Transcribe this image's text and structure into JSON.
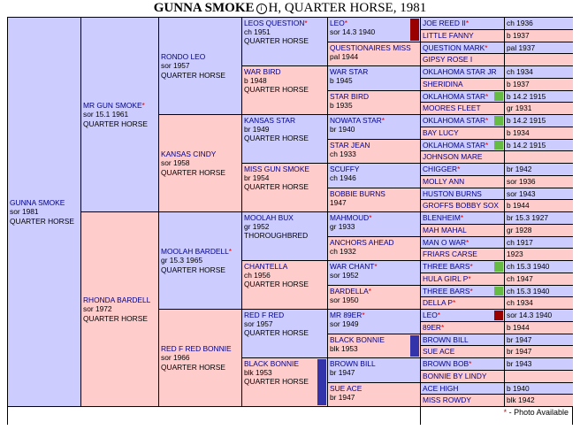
{
  "header": {
    "name": "GUNNA SMOKE",
    "info_icon": "info-circle-icon",
    "rest": "H, QUARTER HORSE, 1981"
  },
  "photo_note": "- Photo Available",
  "star_mark": "*",
  "colors": {
    "male": "#ccccff",
    "female": "#ffcccc",
    "border": "#000000",
    "link": "#00008b",
    "star": "#e00000",
    "red_swatch": "#990000",
    "blue_swatch": "#3333aa",
    "green_swatch": "#66bb44"
  },
  "horses": [
    {
      "name": "GUNNA SMOKE",
      "lines": [
        "sor 1981",
        "QUARTER HORSE"
      ]
    },
    {
      "name": "MR GUN SMOKE",
      "photo": true,
      "lines": [
        "sor 15.1 1961",
        "QUARTER HORSE"
      ]
    },
    {
      "name": "RONDO LEO",
      "lines": [
        "sor 1957",
        "QUARTER HORSE"
      ]
    },
    {
      "name": "LEOS QUESTION",
      "photo": true,
      "lines": [
        "ch 1951",
        "QUARTER HORSE"
      ]
    },
    {
      "name": "LEO",
      "photo": true,
      "lines": [
        "sor 14.3 1940"
      ],
      "swatch": "red"
    },
    {
      "name": "JOE REED II",
      "photo": true,
      "lines": [
        "ch 1936"
      ]
    },
    {
      "name": "LITTLE FANNY",
      "lines": [
        "b 1937"
      ]
    },
    {
      "name": "QUESTIONAIRES MISS",
      "lines": [
        "pal 1944"
      ]
    },
    {
      "name": "QUESTION MARK",
      "photo": true,
      "lines": [
        "pal 1937"
      ]
    },
    {
      "name": "GIPSY ROSE I",
      "lines": [
        ""
      ]
    },
    {
      "name": "WAR BIRD",
      "lines": [
        "b 1948",
        "QUARTER HORSE"
      ]
    },
    {
      "name": "WAR STAR",
      "lines": [
        "b 1945"
      ]
    },
    {
      "name": "OKLAHOMA STAR JR",
      "lines": [
        "ch 1934"
      ]
    },
    {
      "name": "SHERIDINA",
      "lines": [
        "b 1937"
      ]
    },
    {
      "name": "STAR BIRD",
      "lines": [
        "b 1935"
      ]
    },
    {
      "name": "OKLAHOMA STAR",
      "photo": true,
      "lines": [
        "b 14.2 1915"
      ],
      "swatch": "green"
    },
    {
      "name": "MOORES FLEET",
      "lines": [
        "gr 1931"
      ]
    },
    {
      "name": "KANSAS CINDY",
      "lines": [
        "sor 1958",
        "QUARTER HORSE"
      ]
    },
    {
      "name": "KANSAS STAR",
      "lines": [
        "br 1949",
        "QUARTER HORSE"
      ]
    },
    {
      "name": "NOWATA STAR",
      "photo": true,
      "lines": [
        "br 1940"
      ]
    },
    {
      "name": "OKLAHOMA STAR",
      "photo": true,
      "lines": [
        "b 14.2 1915"
      ],
      "swatch": "green"
    },
    {
      "name": "BAY LUCY",
      "lines": [
        "b 1934"
      ]
    },
    {
      "name": "STAR JEAN",
      "lines": [
        "ch 1933"
      ]
    },
    {
      "name": "OKLAHOMA STAR",
      "photo": true,
      "lines": [
        "b 14.2 1915"
      ],
      "swatch": "green"
    },
    {
      "name": "JOHNSON MARE",
      "lines": [
        ""
      ]
    },
    {
      "name": "MISS GUN SMOKE",
      "lines": [
        "br 1954",
        "QUARTER HORSE"
      ]
    },
    {
      "name": "SCUFFY",
      "lines": [
        "ch 1946"
      ]
    },
    {
      "name": "CHIGGER",
      "photo": true,
      "lines": [
        "br 1942"
      ]
    },
    {
      "name": "MOLLY ANN",
      "lines": [
        "sor 1936"
      ]
    },
    {
      "name": "BOBBIE BURNS",
      "lines": [
        "1947"
      ]
    },
    {
      "name": "HUSTON BURNS",
      "lines": [
        "sor 1943"
      ]
    },
    {
      "name": "GROFFS BOBBY SOX",
      "lines": [
        "b 1944"
      ]
    },
    {
      "name": "RHONDA BARDELL",
      "lines": [
        "sor 1972",
        "QUARTER HORSE"
      ]
    },
    {
      "name": "MOOLAH BARDELL",
      "photo": true,
      "lines": [
        "gr 15.3 1965",
        "QUARTER HORSE"
      ]
    },
    {
      "name": "MOOLAH BUX",
      "lines": [
        "gr 1952",
        "THOROUGHBRED"
      ]
    },
    {
      "name": "MAHMOUD",
      "photo": true,
      "lines": [
        "gr 1933"
      ]
    },
    {
      "name": "BLENHEIM",
      "photo": true,
      "lines": [
        "br 15.3 1927"
      ]
    },
    {
      "name": "MAH MAHAL",
      "lines": [
        "gr 1928"
      ]
    },
    {
      "name": "ANCHORS AHEAD",
      "lines": [
        "ch 1932"
      ]
    },
    {
      "name": "MAN O WAR",
      "photo": true,
      "lines": [
        "ch 1917"
      ]
    },
    {
      "name": "FRIARS CARSE",
      "lines": [
        "1923"
      ]
    },
    {
      "name": "CHANTELLA",
      "lines": [
        "ch 1956",
        "QUARTER HORSE"
      ]
    },
    {
      "name": "WAR CHANT",
      "photo": true,
      "lines": [
        "sor 1952"
      ]
    },
    {
      "name": "THREE BARS",
      "photo": true,
      "lines": [
        "ch 15.3 1940"
      ],
      "swatch": "green"
    },
    {
      "name": "HULA GIRL P",
      "photo": true,
      "lines": [
        "ch 1947"
      ]
    },
    {
      "name": "BARDELLA",
      "photo": true,
      "lines": [
        "sor 1950"
      ]
    },
    {
      "name": "THREE BARS",
      "photo": true,
      "lines": [
        "ch 15.3 1940"
      ],
      "swatch": "green"
    },
    {
      "name": "DELLA P",
      "photo": true,
      "lines": [
        "ch 1934"
      ]
    },
    {
      "name": "RED F RED BONNIE",
      "lines": [
        "sor 1966",
        "QUARTER HORSE"
      ]
    },
    {
      "name": "RED F RED",
      "lines": [
        "sor 1957",
        "QUARTER HORSE"
      ]
    },
    {
      "name": "MR 89ER",
      "photo": true,
      "lines": [
        "sor 1949"
      ]
    },
    {
      "name": "LEO",
      "photo": true,
      "lines": [
        "sor 14.3 1940"
      ],
      "swatch": "red"
    },
    {
      "name": "89ER",
      "photo": true,
      "lines": [
        "b 1944"
      ]
    },
    {
      "name": "BLACK BONNIE",
      "lines": [
        "blk 1953"
      ],
      "swatch": "blue"
    },
    {
      "name": "BROWN BILL",
      "lines": [
        "br 1947"
      ]
    },
    {
      "name": "SUE ACE",
      "lines": [
        "br 1947"
      ]
    },
    {
      "name": "BLACK BONNIE",
      "lines": [
        "blk 1953",
        "QUARTER HORSE"
      ],
      "swatch": "blue"
    },
    {
      "name": "BROWN BILL",
      "lines": [
        "br 1947"
      ]
    },
    {
      "name": "BROWN BOB",
      "photo": true,
      "lines": [
        "br 1943"
      ]
    },
    {
      "name": "BONNIE BY LINDY",
      "lines": [
        ""
      ]
    },
    {
      "name": "SUE ACE",
      "lines": [
        "br 1947"
      ]
    },
    {
      "name": "ACE HIGH",
      "lines": [
        "b 1940"
      ]
    },
    {
      "name": "MISS ROWDY",
      "lines": [
        "blk 1942"
      ]
    }
  ]
}
